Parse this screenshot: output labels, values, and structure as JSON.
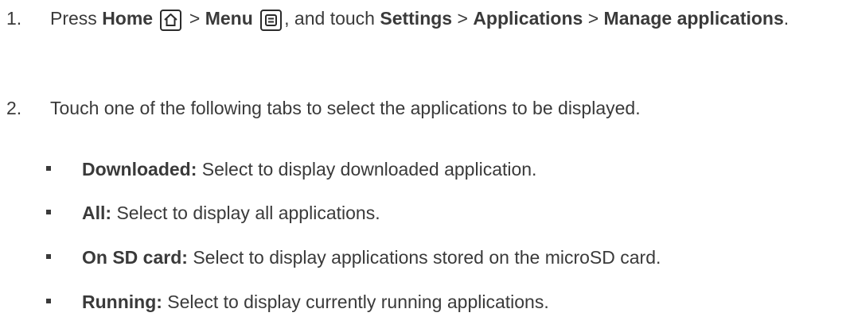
{
  "steps": [
    {
      "number": "1.",
      "press": "Press",
      "home_label": "Home",
      "sep1": ">",
      "menu_label": "Menu",
      "touch_text": ", and touch",
      "settings_label": "Settings",
      "sep2": ">",
      "applications_label": "Applications",
      "sep3": ">",
      "manage_label": "Manage applications",
      "period": "."
    },
    {
      "number": "2.",
      "text": "Touch one of the following tabs to select the applications to be displayed."
    }
  ],
  "bullets": [
    {
      "label": "Downloaded:",
      "text": "Select to display downloaded application."
    },
    {
      "label": "All:",
      "text": "Select to display all applications."
    },
    {
      "label": "On SD card:",
      "text": "Select to display applications stored on the microSD card."
    },
    {
      "label": "Running:",
      "text": "Select to display currently running applications."
    }
  ],
  "icons": {
    "home": "home-icon",
    "menu": "menu-icon"
  }
}
